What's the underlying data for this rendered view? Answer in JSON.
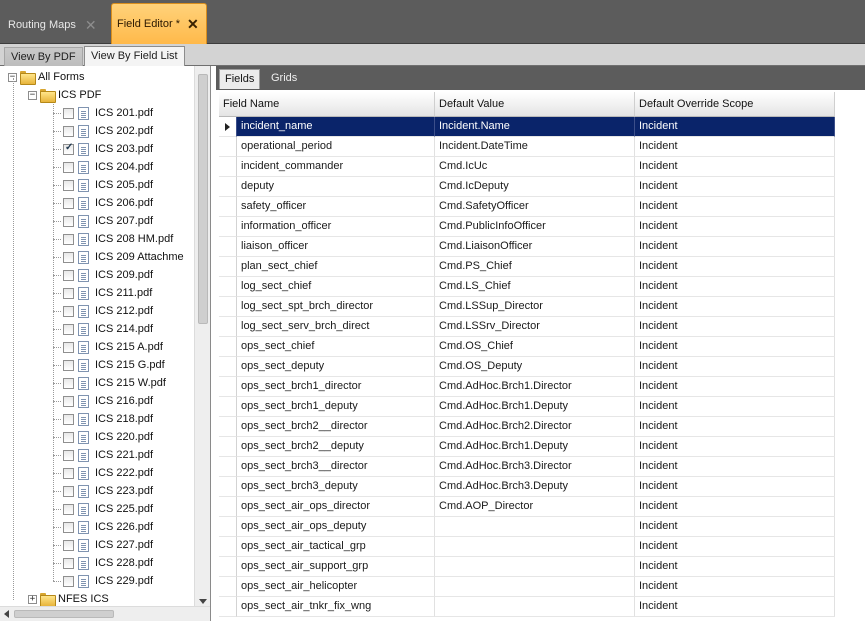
{
  "doc_tabs": [
    {
      "label": "Routing Maps",
      "active": false
    },
    {
      "label": "Field Editor *",
      "active": true
    }
  ],
  "close_glyph": "✕",
  "view_tabs": [
    {
      "label": "View By PDF",
      "active": false
    },
    {
      "label": "View By Field List",
      "active": true
    }
  ],
  "tree": {
    "root": {
      "label": "All Forms",
      "expander": "−",
      "icon": "folder-icon"
    },
    "group": {
      "label": "ICS PDF",
      "expander": "−",
      "icon": "folder-icon"
    },
    "items": [
      {
        "label": "ICS 201.pdf",
        "checked": false
      },
      {
        "label": "ICS 202.pdf",
        "checked": false
      },
      {
        "label": "ICS 203.pdf",
        "checked": true
      },
      {
        "label": "ICS 204.pdf",
        "checked": false
      },
      {
        "label": "ICS 205.pdf",
        "checked": false
      },
      {
        "label": "ICS 206.pdf",
        "checked": false
      },
      {
        "label": "ICS 207.pdf",
        "checked": false
      },
      {
        "label": "ICS 208 HM.pdf",
        "checked": false
      },
      {
        "label": "ICS 209 Attachme",
        "checked": false
      },
      {
        "label": "ICS 209.pdf",
        "checked": false
      },
      {
        "label": "ICS 211.pdf",
        "checked": false
      },
      {
        "label": "ICS 212.pdf",
        "checked": false
      },
      {
        "label": "ICS 214.pdf",
        "checked": false
      },
      {
        "label": "ICS 215 A.pdf",
        "checked": false
      },
      {
        "label": "ICS 215 G.pdf",
        "checked": false
      },
      {
        "label": "ICS 215 W.pdf",
        "checked": false
      },
      {
        "label": "ICS 216.pdf",
        "checked": false
      },
      {
        "label": "ICS 218.pdf",
        "checked": false
      },
      {
        "label": "ICS 220.pdf",
        "checked": false
      },
      {
        "label": "ICS 221.pdf",
        "checked": false
      },
      {
        "label": "ICS 222.pdf",
        "checked": false
      },
      {
        "label": "ICS 223.pdf",
        "checked": false
      },
      {
        "label": "ICS 225.pdf",
        "checked": false
      },
      {
        "label": "ICS 226.pdf",
        "checked": false
      },
      {
        "label": "ICS 227.pdf",
        "checked": false
      },
      {
        "label": "ICS 228.pdf",
        "checked": false
      },
      {
        "label": "ICS 229.pdf",
        "checked": false
      }
    ],
    "collapsed_group": {
      "label": "NFES ICS",
      "expander": "+",
      "icon": "folder-icon"
    }
  },
  "inner_tabs": [
    {
      "label": "Fields",
      "active": true
    },
    {
      "label": "Grids",
      "active": false
    }
  ],
  "grid": {
    "columns": [
      "Field Name",
      "Default Value",
      "Default Override Scope"
    ],
    "selected_index": 0,
    "rows": [
      [
        "incident_name",
        "Incident.Name",
        "Incident"
      ],
      [
        "operational_period",
        "Incident.DateTime",
        "Incident"
      ],
      [
        "incident_commander",
        "Cmd.IcUc",
        "Incident"
      ],
      [
        "deputy",
        "Cmd.IcDeputy",
        "Incident"
      ],
      [
        "safety_officer",
        "Cmd.SafetyOfficer",
        "Incident"
      ],
      [
        "information_officer",
        "Cmd.PublicInfoOfficer",
        "Incident"
      ],
      [
        "liaison_officer",
        "Cmd.LiaisonOfficer",
        "Incident"
      ],
      [
        "plan_sect_chief",
        "Cmd.PS_Chief",
        "Incident"
      ],
      [
        "log_sect_chief",
        "Cmd.LS_Chief",
        "Incident"
      ],
      [
        "log_sect_spt_brch_director",
        "Cmd.LSSup_Director",
        "Incident"
      ],
      [
        "log_sect_serv_brch_direct",
        "Cmd.LSSrv_Director",
        "Incident"
      ],
      [
        "ops_sect_chief",
        "Cmd.OS_Chief",
        "Incident"
      ],
      [
        "ops_sect_deputy",
        "Cmd.OS_Deputy",
        "Incident"
      ],
      [
        "ops_sect_brch1_director",
        "Cmd.AdHoc.Brch1.Director",
        "Incident"
      ],
      [
        "ops_sect_brch1_deputy",
        "Cmd.AdHoc.Brch1.Deputy",
        "Incident"
      ],
      [
        "ops_sect_brch2__director",
        "Cmd.AdHoc.Brch2.Director",
        "Incident"
      ],
      [
        "ops_sect_brch2__deputy",
        "Cmd.AdHoc.Brch1.Deputy",
        "Incident"
      ],
      [
        "ops_sect_brch3__director",
        "Cmd.AdHoc.Brch3.Director",
        "Incident"
      ],
      [
        "ops_sect_brch3_deputy",
        "Cmd.AdHoc.Brch3.Deputy",
        "Incident"
      ],
      [
        "ops_sect_air_ops_director",
        "Cmd.AOP_Director",
        "Incident"
      ],
      [
        "ops_sect_air_ops_deputy",
        "",
        "Incident"
      ],
      [
        "ops_sect_air_tactical_grp",
        "",
        "Incident"
      ],
      [
        "ops_sect_air_support_grp",
        "",
        "Incident"
      ],
      [
        "ops_sect_air_helicopter",
        "",
        "Incident"
      ],
      [
        "ops_sect_air_tnkr_fix_wng",
        "",
        "Incident"
      ]
    ]
  }
}
